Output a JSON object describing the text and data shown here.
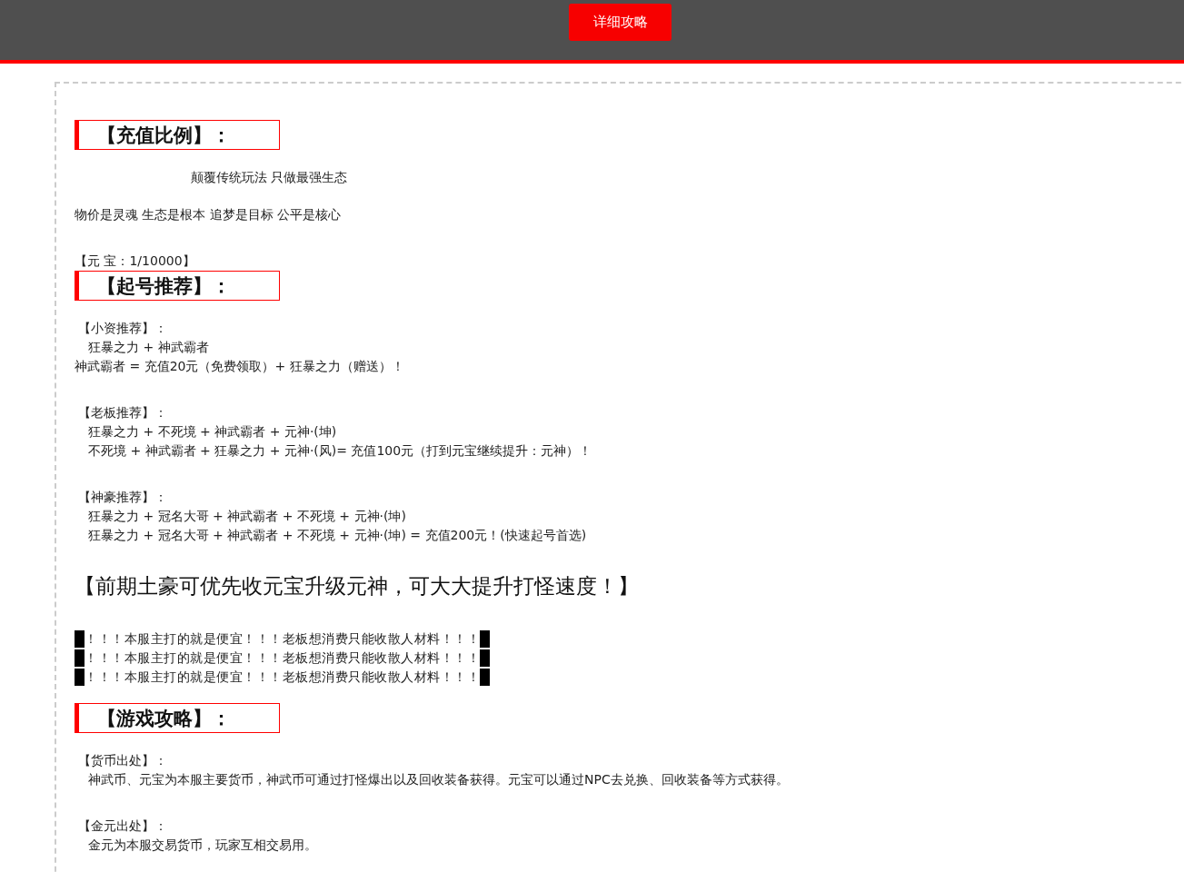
{
  "header": {
    "button": "详细攻略"
  },
  "blocks": [
    {
      "kind": "heading",
      "text": "【充值比例】："
    },
    {
      "kind": "text",
      "lines": [
        {
          "kind": "lead",
          "text": "颠覆传统玩法 只做最强生态"
        },
        {
          "kind": "plain",
          "text": "物价是灵魂 生态是根本 追梦是目标 公平是核心"
        }
      ]
    },
    {
      "kind": "text",
      "lines": [
        {
          "kind": "plain",
          "text": "【元 宝：1/10000】"
        }
      ]
    },
    {
      "kind": "heading",
      "text": "【起号推荐】："
    },
    {
      "kind": "text",
      "lines": [
        {
          "kind": "label",
          "text": "【小资推荐】："
        },
        {
          "kind": "indented",
          "text": "狂暴之力 + 神武霸者"
        },
        {
          "kind": "plain",
          "text": "神武霸者 = 充值20元（免费领取）+ 狂暴之力（赠送）！"
        }
      ]
    },
    {
      "kind": "text",
      "lines": [
        {
          "kind": "label",
          "text": "【老板推荐】："
        },
        {
          "kind": "indented",
          "text": "狂暴之力 + 不死境 + 神武霸者 + 元神·(坤)"
        },
        {
          "kind": "indented",
          "text": "不死境 + 神武霸者 + 狂暴之力 + 元神·(风)= 充值100元（打到元宝继续提升：元神）！"
        }
      ]
    },
    {
      "kind": "text",
      "lines": [
        {
          "kind": "label",
          "text": "【神豪推荐】："
        },
        {
          "kind": "indented",
          "text": "狂暴之力 + 冠名大哥 + 神武霸者 + 不死境 + 元神·(坤)"
        },
        {
          "kind": "indented",
          "text": "狂暴之力 + 冠名大哥 + 神武霸者 + 不死境 + 元神·(坤) = 充值200元！(快速起号首选)"
        }
      ]
    },
    {
      "kind": "big",
      "text": "【前期土豪可优先收元宝升级元神，可大大提升打怪速度！】"
    },
    {
      "kind": "notice",
      "lines": [
        "！！！本服主打的就是便宜！！！老板想消费只能收散人材料！！！",
        "！！！本服主打的就是便宜！！！老板想消费只能收散人材料！！！",
        "！！！本服主打的就是便宜！！！老板想消费只能收散人材料！！！"
      ]
    },
    {
      "kind": "heading",
      "text": "【游戏攻略】："
    },
    {
      "kind": "text",
      "lines": [
        {
          "kind": "label",
          "text": "【货币出处】："
        },
        {
          "kind": "indented",
          "text": "神武币、元宝为本服主要货币，神武币可通过打怪爆出以及回收装备获得。元宝可以通过NPC去兑换、回收装备等方式获得。"
        }
      ]
    },
    {
      "kind": "text",
      "lines": [
        {
          "kind": "label",
          "text": "【金元出处】："
        },
        {
          "kind": "indented",
          "text": "金元为本服交易货币，玩家互相交易用。"
        }
      ]
    }
  ]
}
